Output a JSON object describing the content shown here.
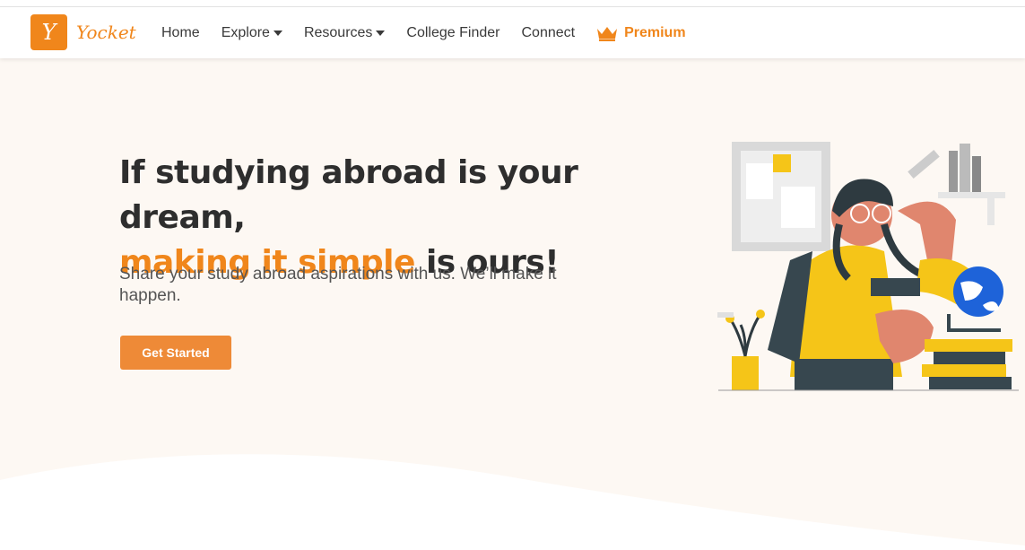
{
  "brand": {
    "logo_letter": "Y",
    "name": "Yocket",
    "accent": "#f0861b"
  },
  "nav": {
    "items": [
      {
        "label": "Home"
      },
      {
        "label": "Explore"
      },
      {
        "label": "Resources"
      },
      {
        "label": "College Finder"
      },
      {
        "label": "Connect"
      }
    ],
    "premium_label": "Premium"
  },
  "hero": {
    "title_line1": "If studying abroad is your dream,",
    "title_accent": "making it simple",
    "title_rest": " is ours!",
    "subtitle": "Share your study abroad aspirations with us. We’ll make it happen.",
    "cta_label": "Get Started"
  },
  "icons": [
    "caret-down-icon",
    "crown-icon"
  ],
  "colors": {
    "background": "#fdf8f3",
    "button": "#ee8a37",
    "text": "#2e2e2e"
  }
}
